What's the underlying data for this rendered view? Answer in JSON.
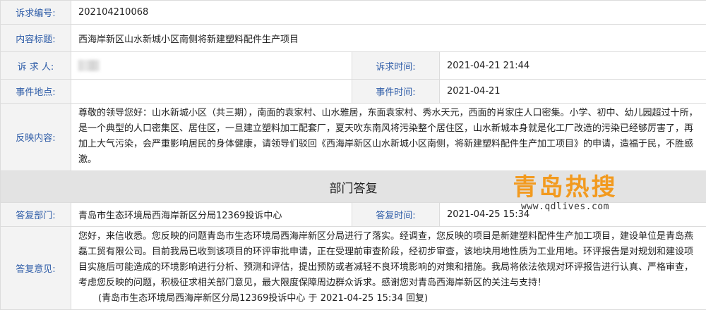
{
  "complaint": {
    "number_label": "诉求编号:",
    "number": "202104210068",
    "title_label": "内容标题:",
    "title": "西海岸新区山水新城小区南侧将新建塑料配件生产项目",
    "person_label": "诉 求 人:",
    "time_label": "诉求时间:",
    "time": "2021-04-21 21:44",
    "place_label": "事件地点:",
    "place": "",
    "event_time_label": "事件时间:",
    "event_time": "2021-04-21",
    "content_label": "反映内容:",
    "content": "尊敬的领导您好：山水新城小区（共三期），南面的袁家村、山水雅居，东面袁家村、秀水天元，西面的肖家庄人口密集。小学、初中、幼儿园超过十所，是一个典型的人口密集区、居住区，一旦建立塑料加工配套厂，夏天吹东南风将污染整个居住区，山水新城本身就是化工厂改造的污染已经够厉害了，再加上大气污染，会严重影响居民的身体健康，请领导们驳回《西海岸新区山水新城小区南侧，将新建塑料配件生产加工项目》的申请，造福于民，不胜感激。"
  },
  "reply": {
    "section_title": "部门答复",
    "dept_label": "答复部门:",
    "dept": "青岛市生态环境局西海岸新区分局12369投诉中心",
    "time_label": "答复时间:",
    "time": "2021-04-25 15:34",
    "opinion_label": "答复意见:",
    "opinion": "您好，来信收悉。您反映的问题青岛市生态环境局西海岸新区分局进行了落实。经调查，您反映的项目是新建塑料配件生产加工项目，建设单位是青岛燕磊工贸有限公司。目前我局已收到该项目的环评审批申请，正在受理前审查阶段，经初步审查，该地块用地性质为工业用地。环评报告是对规划和建设项目实施后可能造成的环境影响进行分析、预测和评估，提出预防或者减轻不良环境影响的对策和措施。我局将依法依规对环评报告进行认真、严格审查，考虑您反映的问题，积极征求相关部门意见，最大限度保障周边群众诉求。感谢您对青岛西海岸新区的关注与支持！",
    "signature": "(青岛市生态环境局西海岸新区分局12369投诉中心 于 2021-04-25 15:34 回复)"
  },
  "watermark": {
    "title": "青岛热搜",
    "url": "www.qdlives.com",
    "color": "#f29a1f"
  },
  "colors": {
    "label_text": "#2f5da8",
    "label_bg": "#f3f3f3",
    "section_bg": "#e3e3e3",
    "border": "#dcdcdc"
  }
}
